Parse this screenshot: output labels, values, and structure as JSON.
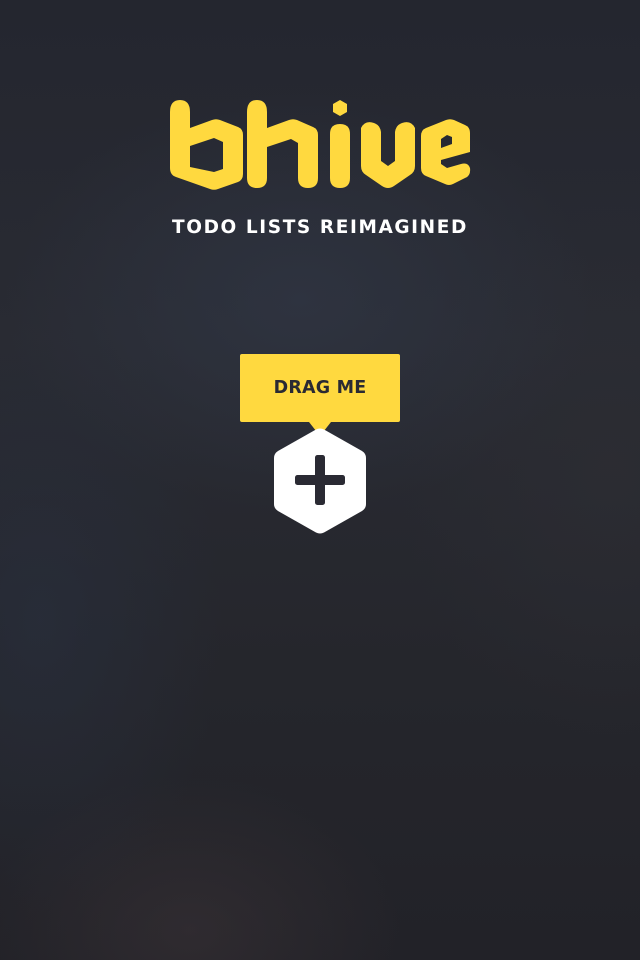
{
  "brand": {
    "logo_text": "bhive",
    "tagline": "TODO LISTS REIMAGINED"
  },
  "drag_hint": {
    "label": "DRAG ME"
  },
  "add_button": {
    "icon": "plus-icon"
  },
  "colors": {
    "accent": "#ffd93f",
    "background": "#26272d",
    "hex_fill": "#ffffff",
    "icon": "#2a2a33",
    "text": "#ffffff"
  }
}
